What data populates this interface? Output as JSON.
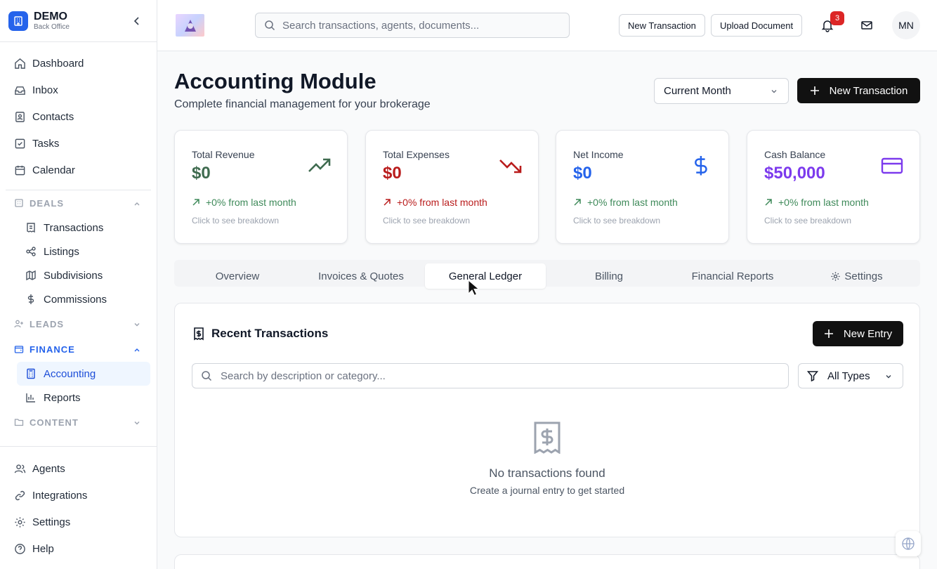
{
  "brand": {
    "name": "DEMO",
    "subtitle": "Back Office"
  },
  "nav": {
    "dashboard": "Dashboard",
    "inbox": "Inbox",
    "contacts": "Contacts",
    "tasks": "Tasks",
    "calendar": "Calendar",
    "deals": {
      "label": "DEALS",
      "items": [
        "Transactions",
        "Listings",
        "Subdivisions",
        "Commissions"
      ]
    },
    "leads": {
      "label": "LEADS"
    },
    "finance": {
      "label": "FINANCE",
      "items": [
        "Accounting",
        "Reports"
      ]
    },
    "content": {
      "label": "CONTENT"
    },
    "agents": "Agents",
    "integrations": "Integrations",
    "settings": "Settings",
    "help": "Help"
  },
  "header": {
    "search_placeholder": "Search transactions, agents, documents...",
    "new_transaction": "New Transaction",
    "upload_document": "Upload Document",
    "notification_count": "3",
    "avatar_initials": "MN"
  },
  "page": {
    "title": "Accounting Module",
    "subtitle": "Complete financial management for your brokerage",
    "period": "Current Month",
    "new_transaction": "New Transaction"
  },
  "cards": [
    {
      "label": "Total Revenue",
      "value": "$0",
      "change": "+0% from last month",
      "hint": "Click to see breakdown",
      "icon": "trending-up-icon",
      "value_color": "#3f6b4f"
    },
    {
      "label": "Total Expenses",
      "value": "$0",
      "change": "+0% from last month",
      "hint": "Click to see breakdown",
      "icon": "trending-down-icon",
      "value_color": "#b91c1c"
    },
    {
      "label": "Net Income",
      "value": "$0",
      "change": "+0% from last month",
      "hint": "Click to see breakdown",
      "icon": "dollar-icon",
      "value_color": "#2563eb"
    },
    {
      "label": "Cash Balance",
      "value": "$50,000",
      "change": "+0% from last month",
      "hint": "Click to see breakdown",
      "icon": "credit-card-icon",
      "value_color": "#7c3aed"
    }
  ],
  "tabs": [
    "Overview",
    "Invoices & Quotes",
    "General Ledger",
    "Billing",
    "Financial Reports",
    "Settings"
  ],
  "active_tab": "General Ledger",
  "ledger": {
    "title": "Recent Transactions",
    "new_entry": "New Entry",
    "search_placeholder": "Search by description or category...",
    "type_filter": "All Types",
    "empty_title": "No transactions found",
    "empty_subtitle": "Create a journal entry to get started"
  }
}
